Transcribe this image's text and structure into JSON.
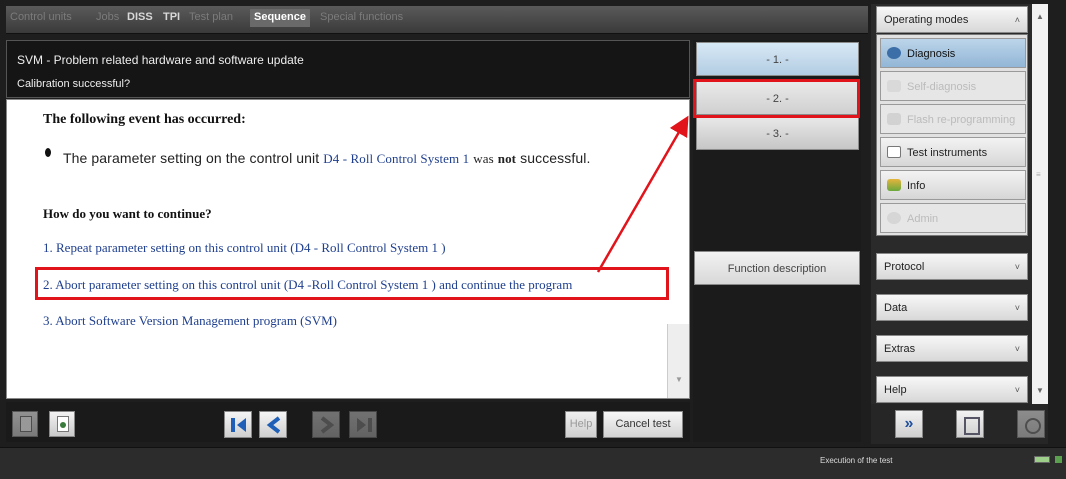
{
  "tabs": [
    {
      "label": "Control units"
    },
    {
      "label": "Jobs"
    },
    {
      "label": "DISS"
    },
    {
      "label": "TPI"
    },
    {
      "label": "Test plan"
    },
    {
      "label": "Sequence"
    },
    {
      "label": "Special functions"
    }
  ],
  "header": {
    "title": "SVM - Problem related hardware and software update",
    "subtitle": "Calibration successful?"
  },
  "content": {
    "event_heading": "The following event has occurred:",
    "event_text_1": "The parameter setting on the control unit",
    "event_unit": "D4 - Roll Control System 1",
    "event_text_2": "was",
    "event_not": "not",
    "event_text_3": "successful.",
    "question": "How do you want to continue?",
    "options": [
      "1. Repeat parameter setting on this control unit (D4 - Roll Control System 1 )",
      "2. Abort parameter setting on this control unit (D4 -Roll Control System 1 ) and continue the program",
      "3. Abort Software Version Management program (SVM)"
    ]
  },
  "bottombar": {
    "help_label": "Help",
    "cancel_label": "Cancel test"
  },
  "steps": [
    "- 1. -",
    "- 2. -",
    "- 3. -"
  ],
  "function_description": "Function description",
  "right_panel": {
    "operating_modes": "Operating modes",
    "modes": [
      "Diagnosis",
      "Self-diagnosis",
      "Flash re-programming",
      "Test instruments",
      "Info",
      "Admin"
    ],
    "protocol": "Protocol",
    "data": "Data",
    "extras": "Extras",
    "help": "Help"
  },
  "status": {
    "text": "Execution of the test"
  },
  "colors": {
    "highlight": "#e2141b",
    "link": "#1f3f8e"
  }
}
